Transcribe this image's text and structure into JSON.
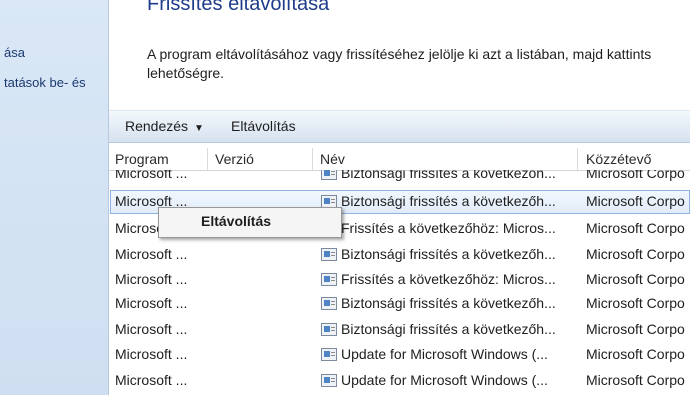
{
  "sidebar": {
    "items": [
      {
        "label": "ása"
      },
      {
        "label": "tatások be- és"
      }
    ]
  },
  "main": {
    "title": "Frissítés eltávolítása",
    "description": "A program eltávolításához vagy frissítéséhez jelölje ki azt a listában, majd kattints lehetőségre."
  },
  "toolbar": {
    "organize_label": "Rendezés",
    "organize_arrow": "▼",
    "uninstall_label": "Eltávolítás"
  },
  "columns": [
    "Program",
    "Verzió",
    "Név",
    "Közzétevő"
  ],
  "rows": [
    {
      "program": "Microsoft ...",
      "version": "",
      "name": "Biztonsági frissítés a következőn...",
      "publisher": "Microsoft Corpo"
    },
    {
      "program": "Microsoft ...",
      "version": "",
      "name": "Biztonsági frissítés a következőh...",
      "publisher": "Microsoft Corpo"
    },
    {
      "program": "Microsoft ...",
      "version": "",
      "name": "Frissítés a következőhöz: Micros...",
      "publisher": "Microsoft Corpo"
    },
    {
      "program": "Microsoft ...",
      "version": "",
      "name": "Biztonsági frissítés a következőh...",
      "publisher": "Microsoft Corpo"
    },
    {
      "program": "Microsoft ...",
      "version": "",
      "name": "Frissítés a következőhöz: Micros...",
      "publisher": "Microsoft Corpo"
    },
    {
      "program": "Microsoft ...",
      "version": "",
      "name": "Biztonsági frissítés a következőh...",
      "publisher": "Microsoft Corpo"
    },
    {
      "program": "Microsoft ...",
      "version": "",
      "name": "Biztonsági frissítés a következőh...",
      "publisher": "Microsoft Corpo"
    },
    {
      "program": "Microsoft ...",
      "version": "",
      "name": "Update for Microsoft Windows (...",
      "publisher": "Microsoft Corpo"
    },
    {
      "program": "Microsoft ...",
      "version": "",
      "name": "Update for Microsoft Windows (...",
      "publisher": "Microsoft Corpo"
    }
  ],
  "context_menu": {
    "items": [
      {
        "label": "Eltávolítás"
      }
    ]
  },
  "icons": {
    "update": "update-package-icon"
  },
  "colors": {
    "title": "#1f3c8a",
    "sidebar_bg": "#d9e7f6",
    "selection_border": "#8fb3df"
  }
}
